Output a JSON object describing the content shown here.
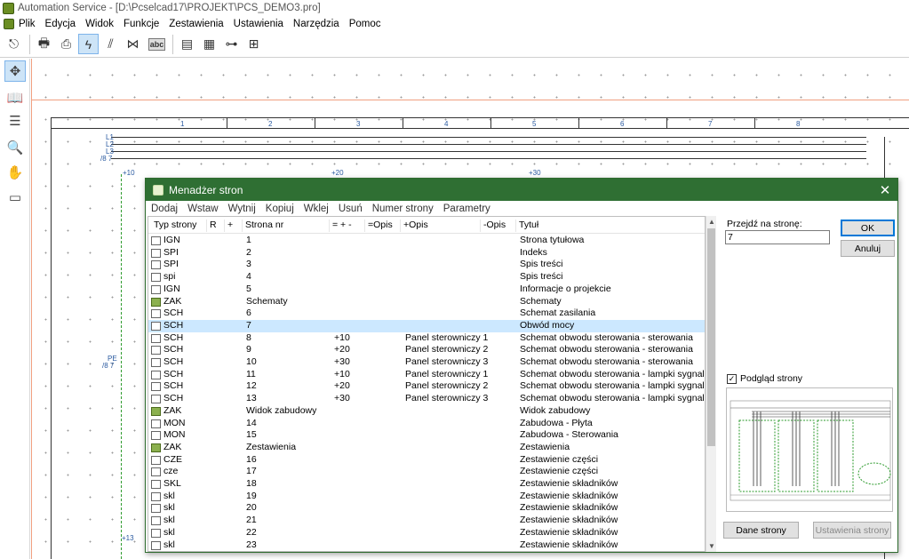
{
  "window": {
    "title": "Automation Service - [D:\\Pcselcad17\\PROJEKT\\PCS_DEMO3.pro]"
  },
  "menu": [
    "Plik",
    "Edycja",
    "Widok",
    "Funkcje",
    "Zestawienia",
    "Ustawienia",
    "Narzędzia",
    "Pomoc"
  ],
  "toolbar_icons": [
    "exit-icon",
    "print-icon",
    "print-preview-icon",
    "lightning-icon",
    "wires-icon",
    "connector-icon",
    "abc-icon",
    "page-icon",
    "calculator-icon",
    "hierarchy-icon",
    "tree-icon"
  ],
  "left_tools": [
    "select-tool-icon",
    "book-icon",
    "list-arrow-icon",
    "zoom-icon",
    "hand-icon",
    "screen-icon"
  ],
  "canvas": {
    "column_numbers": [
      "1",
      "2",
      "3",
      "4",
      "5",
      "6",
      "7",
      "8"
    ],
    "labels": {
      "l1": "L1",
      "l2": "L2",
      "l3": "L3",
      "ref1": "/8 7",
      "ref2": "/8 7",
      "ref3": "/8 7",
      "t10": "+10",
      "t20": "+20",
      "t30": "+30",
      "pe": "PE",
      "pe_ref": "/8 7",
      "t13": "+13"
    }
  },
  "dialog": {
    "title": "Menadżer stron",
    "menu": [
      "Dodaj",
      "Wstaw",
      "Wytnij",
      "Kopiuj",
      "Wklej",
      "Usuń",
      "Numer strony",
      "Parametry"
    ],
    "columns": [
      "Typ strony",
      "R",
      "+",
      "Strona nr",
      "= + -",
      "=Opis",
      "+Opis",
      "-Opis",
      "Tytuł"
    ],
    "rows": [
      {
        "type": "IGN",
        "nr": "1",
        "eq": "",
        "popis": "",
        "title": "Strona tytułowa"
      },
      {
        "type": "SPI",
        "nr": "2",
        "eq": "",
        "popis": "",
        "title": "Indeks"
      },
      {
        "type": "SPI",
        "nr": "3",
        "eq": "",
        "popis": "",
        "title": "Spis treści"
      },
      {
        "type": "spi",
        "nr": "4",
        "eq": "",
        "popis": "",
        "title": "Spis treści"
      },
      {
        "type": "IGN",
        "nr": "5",
        "eq": "",
        "popis": "",
        "title": "Informacje o projekcie"
      },
      {
        "type": "ZAK",
        "nr": "Schematy",
        "eq": "",
        "popis": "",
        "title": "Schematy"
      },
      {
        "type": "SCH",
        "nr": "6",
        "eq": "",
        "popis": "",
        "title": "Schemat zasilania"
      },
      {
        "type": "SCH",
        "nr": "7",
        "eq": "",
        "popis": "",
        "title": "Obwód mocy"
      },
      {
        "type": "SCH",
        "nr": "8",
        "eq": "+10",
        "popis": "Panel sterowniczy 1",
        "title": "Schemat obwodu sterowania - sterowania"
      },
      {
        "type": "SCH",
        "nr": "9",
        "eq": "+20",
        "popis": "Panel sterowniczy 2",
        "title": "Schemat obwodu sterowania - sterowania"
      },
      {
        "type": "SCH",
        "nr": "10",
        "eq": "+30",
        "popis": "Panel sterowniczy 3",
        "title": "Schemat obwodu sterowania - sterowania"
      },
      {
        "type": "SCH",
        "nr": "11",
        "eq": "+10",
        "popis": "Panel sterowniczy 1",
        "title": "Schemat obwodu sterowania - lampki sygnalizacyjne"
      },
      {
        "type": "SCH",
        "nr": "12",
        "eq": "+20",
        "popis": "Panel sterowniczy 2",
        "title": "Schemat obwodu sterowania - lampki sygnalizacyjne"
      },
      {
        "type": "SCH",
        "nr": "13",
        "eq": "+30",
        "popis": "Panel sterowniczy 3",
        "title": "Schemat obwodu sterowania - lampki sygnalizacyjne"
      },
      {
        "type": "ZAK",
        "nr": "Widok zabudowy",
        "eq": "",
        "popis": "",
        "title": "Widok zabudowy"
      },
      {
        "type": "MON",
        "nr": "14",
        "eq": "",
        "popis": "",
        "title": "Zabudowa - Płyta"
      },
      {
        "type": "MON",
        "nr": "15",
        "eq": "",
        "popis": "",
        "title": "Zabudowa - Sterowania"
      },
      {
        "type": "ZAK",
        "nr": "Zestawienia",
        "eq": "",
        "popis": "",
        "title": "Zestawienia"
      },
      {
        "type": "CZE",
        "nr": "16",
        "eq": "",
        "popis": "",
        "title": "Zestawienie części"
      },
      {
        "type": "cze",
        "nr": "17",
        "eq": "",
        "popis": "",
        "title": "Zestawienie części"
      },
      {
        "type": "SKL",
        "nr": "18",
        "eq": "",
        "popis": "",
        "title": "Zestawienie składników"
      },
      {
        "type": "skl",
        "nr": "19",
        "eq": "",
        "popis": "",
        "title": "Zestawienie składników"
      },
      {
        "type": "skl",
        "nr": "20",
        "eq": "",
        "popis": "",
        "title": "Zestawienie składników"
      },
      {
        "type": "skl",
        "nr": "21",
        "eq": "",
        "popis": "",
        "title": "Zestawienie składników"
      },
      {
        "type": "skl",
        "nr": "22",
        "eq": "",
        "popis": "",
        "title": "Zestawienie składników"
      },
      {
        "type": "skl",
        "nr": "23",
        "eq": "",
        "popis": "",
        "title": "Zestawienie składników"
      }
    ],
    "selected_row": 7,
    "goto_label": "Przejdź na stronę:",
    "goto_value": "7",
    "ok": "OK",
    "cancel": "Anuluj",
    "preview_label": "Podgląd strony",
    "preview_checked": true,
    "btn_page_data": "Dane strony",
    "btn_page_settings": "Ustawienia strony"
  }
}
